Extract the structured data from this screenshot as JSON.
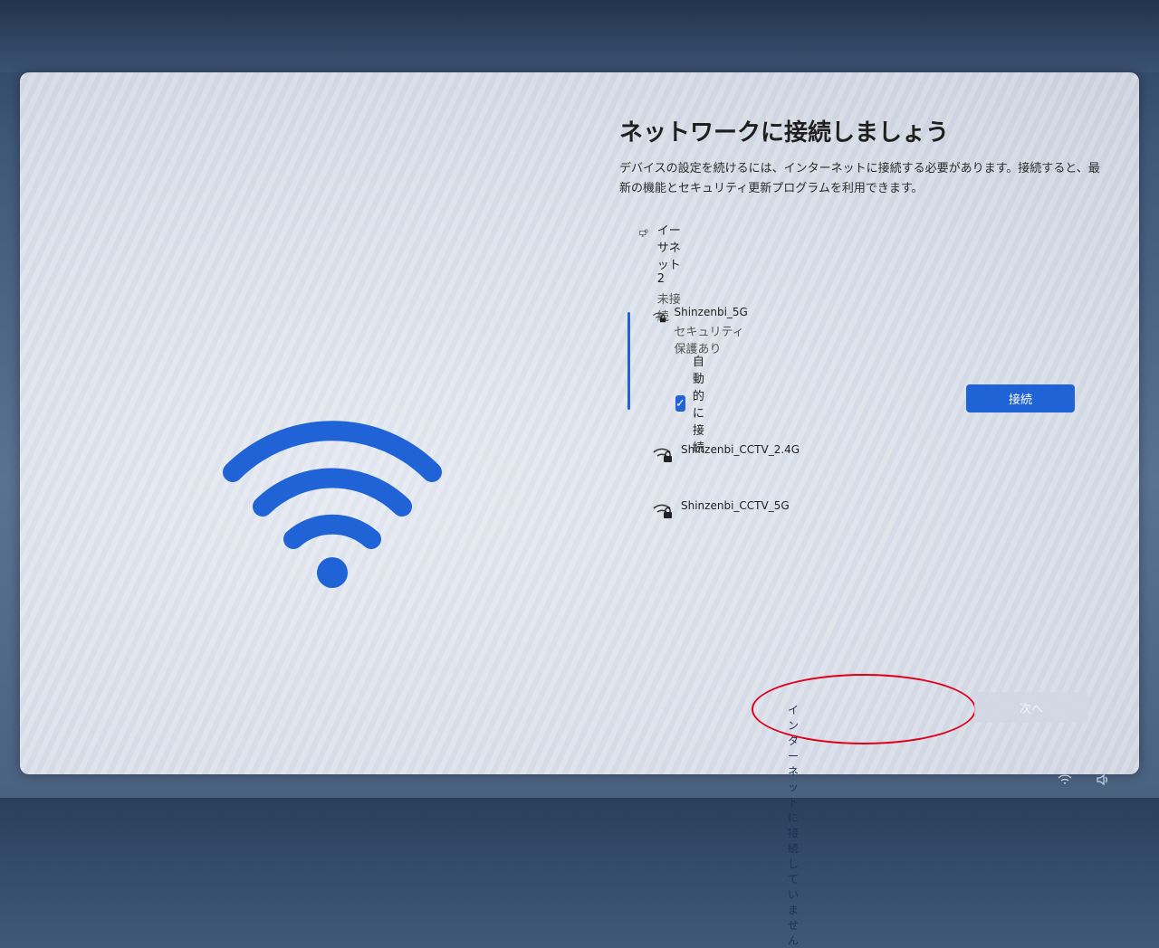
{
  "page": {
    "title": "ネットワークに接続しましょう",
    "description": "デバイスの設定を続けるには、インターネットに接続する必要があります。接続すると、最新の機能とセキュリティ更新プログラムを利用できます。"
  },
  "ethernet": {
    "name": "イーサネット 2",
    "status": "未接続",
    "icon": "ethernet-icon"
  },
  "networks": [
    {
      "ssid": "Shinzenbi_5G",
      "status": "セキュリティ保護あり",
      "icon": "wifi-secure-icon",
      "selected": true
    },
    {
      "ssid": "Shinzenbi_CCTV_2.4G",
      "icon": "wifi-secure-icon"
    },
    {
      "ssid": "Shinzenbi_CCTV_5G",
      "icon": "wifi-secure-icon"
    }
  ],
  "auto_connect": {
    "label": "自動的に接続",
    "checked": true
  },
  "buttons": {
    "connect": "接続",
    "no_internet": "インターネットに接続していません",
    "next": "次へ"
  },
  "colors": {
    "accent": "#1f63d6",
    "annotation": "#e0001b"
  }
}
